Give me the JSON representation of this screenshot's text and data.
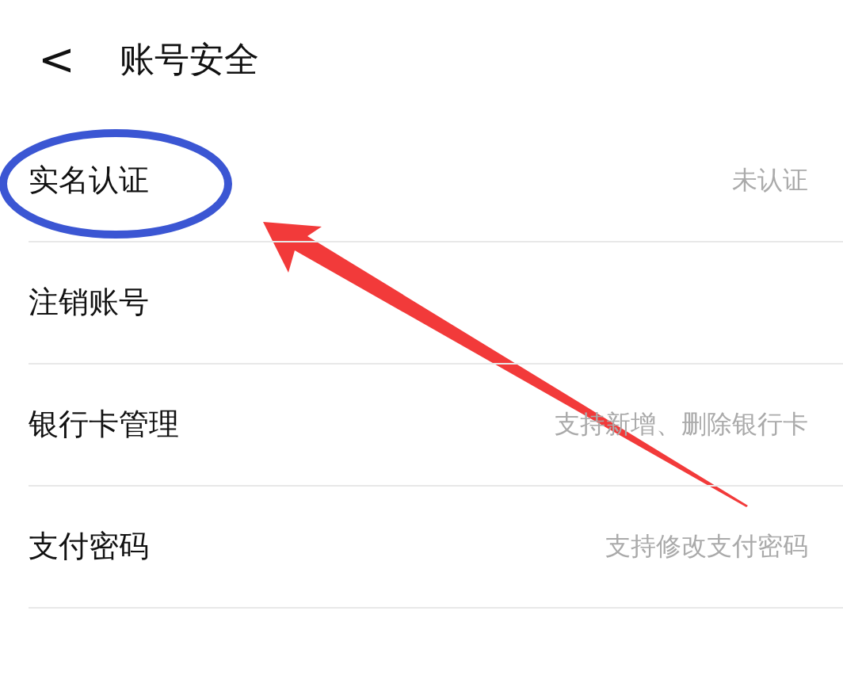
{
  "header": {
    "back": "<",
    "title": "账号安全"
  },
  "rows": [
    {
      "label": "实名认证",
      "detail": "未认证"
    },
    {
      "label": "注销账号"
    },
    {
      "label": "银行卡管理",
      "detail": "支持新增、删除银行卡"
    },
    {
      "label": "支付密码",
      "detail": "支持修改支付密码"
    }
  ]
}
